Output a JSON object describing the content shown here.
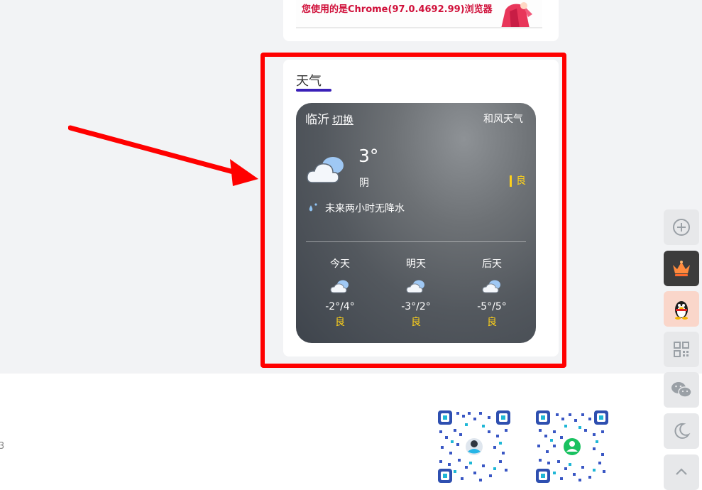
{
  "banner": {
    "browser_notice": "您使用的是Chrome(97.0.4692.99)浏览器"
  },
  "weather_widget": {
    "title": "天气",
    "city": "临沂",
    "switch_label": "切换",
    "provider": "和风天气",
    "current": {
      "temperature": "3°",
      "condition": "阴",
      "aqi": "良",
      "icon": "cloudy-icon"
    },
    "precipitation_note": "未来两小时无降水",
    "forecast": [
      {
        "label": "今天",
        "temp_range": "-2°/4°",
        "aqi": "良",
        "icon": "cloudy-icon"
      },
      {
        "label": "明天",
        "temp_range": "-3°/2°",
        "aqi": "良",
        "icon": "cloudy-icon"
      },
      {
        "label": "后天",
        "temp_range": "-5°/5°",
        "aqi": "良",
        "icon": "cloudy-icon"
      }
    ]
  },
  "footer": {
    "edge_text": "3"
  },
  "float_bar": [
    "plus-circle-icon",
    "crown-icon",
    "qq-penguin-icon",
    "qrcode-icon",
    "wechat-icon",
    "moon-icon",
    "chevron-up-icon"
  ],
  "colors": {
    "highlight": "#ff0000",
    "title_underline": "#3a20b8",
    "aqi": "#ffd21a"
  }
}
